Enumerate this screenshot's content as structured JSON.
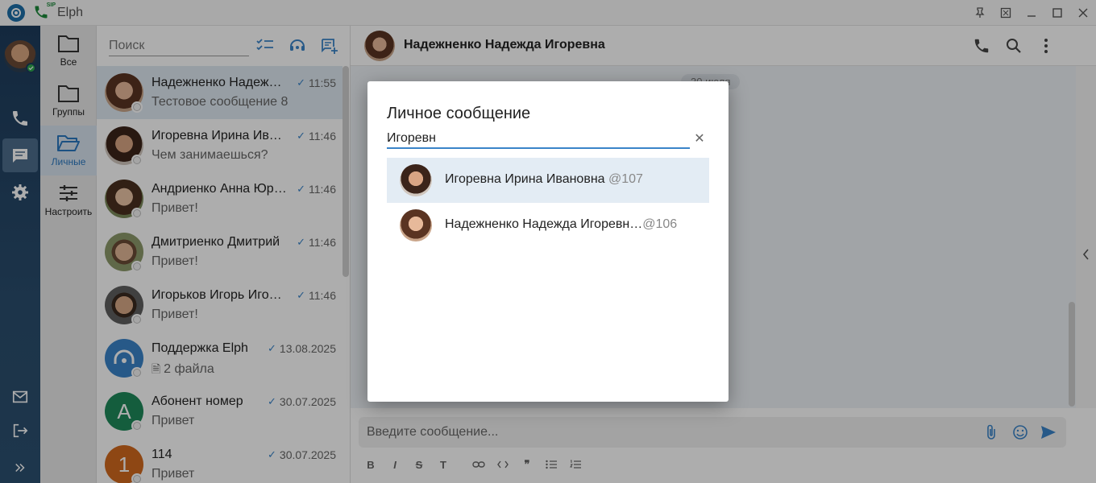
{
  "window": {
    "title": "Elph",
    "sip_label": "SIP"
  },
  "folders": [
    {
      "label": "Все",
      "icon": "folder-icon"
    },
    {
      "label": "Группы",
      "icon": "folder-icon"
    },
    {
      "label": "Личные",
      "icon": "folder-open-icon",
      "active": true
    },
    {
      "label": "Настроить",
      "icon": "sliders-icon"
    }
  ],
  "chatlist": {
    "search_placeholder": "Поиск",
    "chats": [
      {
        "name": "Надежненко Надежда Игоревна",
        "preview": "Тестовое сообщение 8",
        "time": "11:55",
        "selected": true
      },
      {
        "name": "Игоревна Ирина Ивановна",
        "preview": "Чем занимаешься?",
        "time": "11:46"
      },
      {
        "name": "Андриенко Анна Юрьевна",
        "preview": "Привет!",
        "time": "11:46"
      },
      {
        "name": "Дмитриенко Дмитрий",
        "preview": "Привет!",
        "time": "11:46"
      },
      {
        "name": "Игорьков Игорь Игоревич",
        "preview": "Привет!",
        "time": "11:46"
      },
      {
        "name": "Поддержка Elph",
        "preview": "2 файла",
        "time": "13.08.2025"
      },
      {
        "name": "Абонент номер",
        "preview": "Привет",
        "time": "30.07.2025",
        "letter": "A"
      },
      {
        "name": "114",
        "preview": "Привет",
        "time": "30.07.2025",
        "letter": "1"
      }
    ]
  },
  "chat": {
    "title": "Надежненко Надежда Игоревна",
    "date_label": "30 июля",
    "composer_placeholder": "Введите сообщение..."
  },
  "dialog": {
    "title": "Личное сообщение",
    "query": "Игоревн",
    "results": [
      {
        "name": "Игоревна Ирина Ивановна",
        "handle": "@107"
      },
      {
        "name": "Надежненко Надежда Игоревн…",
        "handle": "@106"
      }
    ]
  },
  "colors": {
    "accent": "#3a84c9",
    "rail": "#1d3c5c",
    "online": "#2fa84f",
    "support_avatar": "#3a84c9",
    "letter_a_avatar": "#1e8a5a",
    "letter_1_avatar": "#d2691e"
  }
}
